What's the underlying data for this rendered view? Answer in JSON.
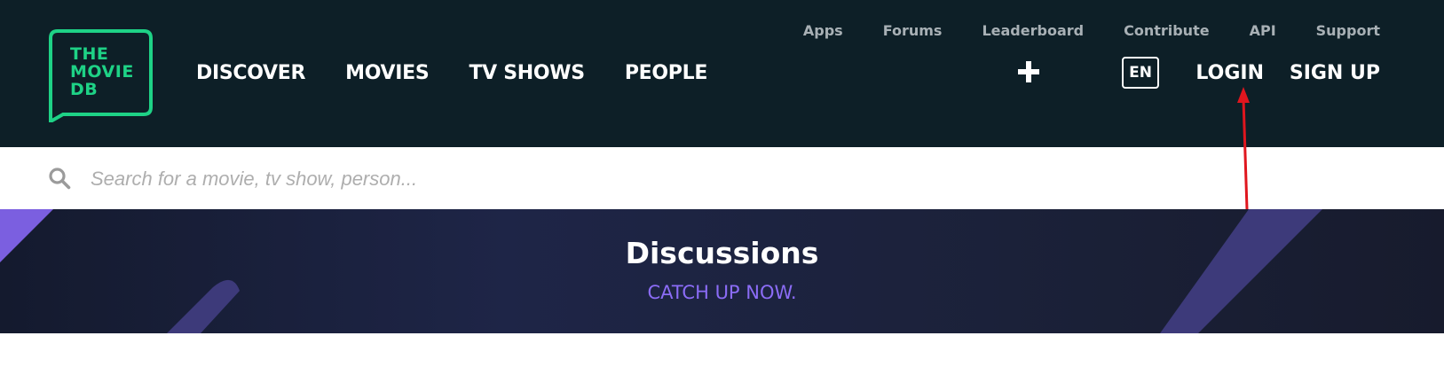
{
  "logo": {
    "text": "THE\nMOVIE\nDB",
    "color": "#1ed286"
  },
  "main_nav": [
    "DISCOVER",
    "MOVIES",
    "TV SHOWS",
    "PEOPLE"
  ],
  "sub_nav": [
    "Apps",
    "Forums",
    "Leaderboard",
    "Contribute",
    "API",
    "Support"
  ],
  "right_nav": {
    "add_icon": "plus-icon",
    "language": "EN",
    "login": "LOGIN",
    "signup": "SIGN UP"
  },
  "search": {
    "placeholder": "Search for a movie, tv show, person...",
    "value": "",
    "icon": "search-icon"
  },
  "banner": {
    "title": "Discussions",
    "link": "CATCH UP NOW.",
    "link_color": "#8b6cf6"
  },
  "colors": {
    "header_bg": "#0d1f27",
    "accent_green": "#1ed286",
    "annotation_red": "#e0161e"
  }
}
